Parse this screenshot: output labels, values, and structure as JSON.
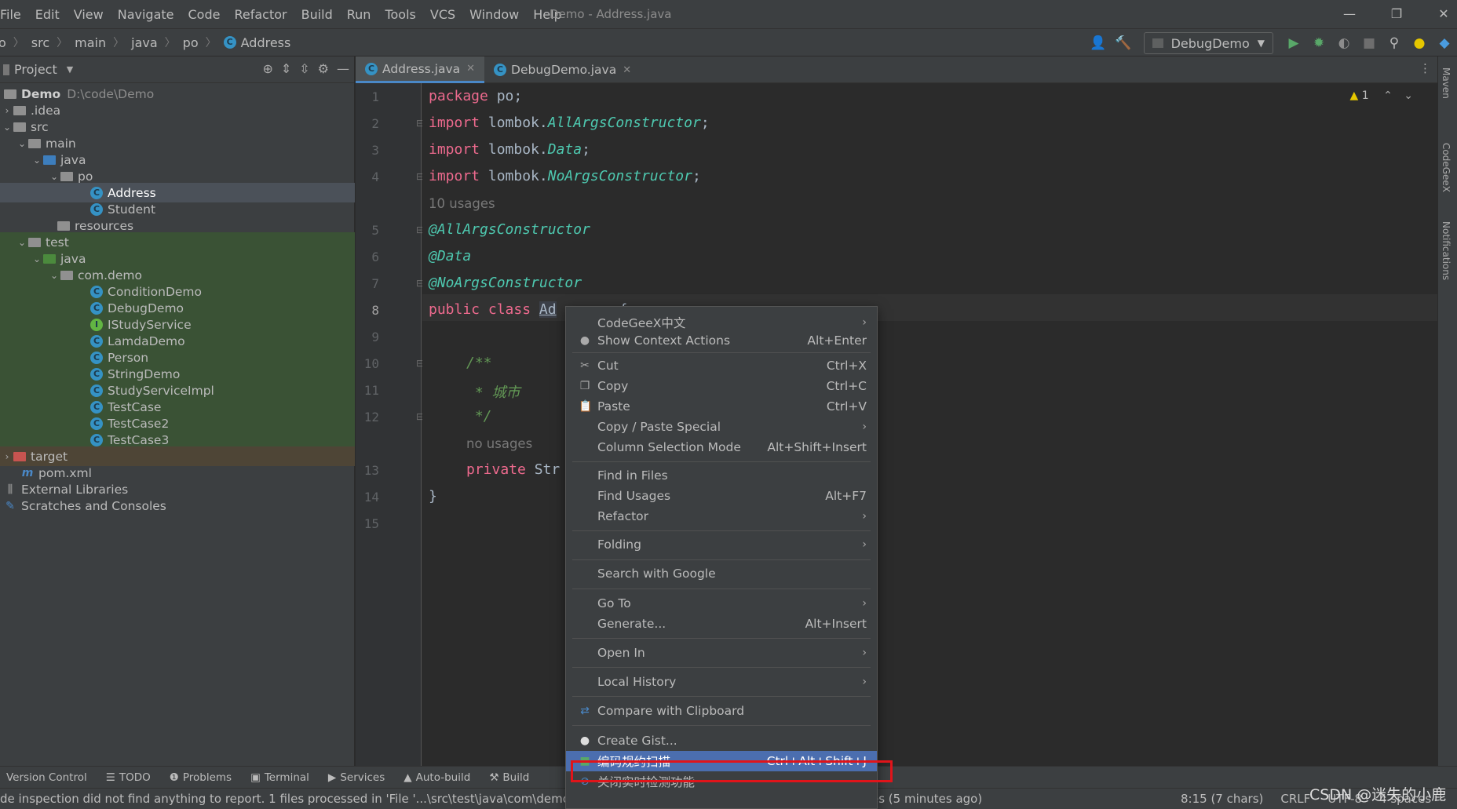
{
  "menu": [
    "File",
    "Edit",
    "View",
    "Navigate",
    "Code",
    "Refactor",
    "Build",
    "Run",
    "Tools",
    "VCS",
    "Window",
    "Help"
  ],
  "window_title": "Demo - Address.java",
  "breadcrumb": [
    "o",
    "src",
    "main",
    "java",
    "po",
    "Address"
  ],
  "run_config": "DebugDemo",
  "project": {
    "title": "Project",
    "root_name": "Demo",
    "root_path": "D:\\code\\Demo",
    "items": {
      "idea": ".idea",
      "src": "src",
      "main": "main",
      "java_main": "java",
      "po": "po",
      "address": "Address",
      "student": "Student",
      "resources": "resources",
      "test": "test",
      "java_test": "java",
      "com_demo": "com.demo",
      "condition_demo": "ConditionDemo",
      "debug_demo": "DebugDemo",
      "istudy_service": "IStudyService",
      "lamda_demo": "LamdaDemo",
      "person": "Person",
      "string_demo": "StringDemo",
      "study_service_impl": "StudyServiceImpl",
      "test_case": "TestCase",
      "test_case2": "TestCase2",
      "test_case3": "TestCase3",
      "target": "target",
      "pom": "pom.xml",
      "external_libraries": "External Libraries",
      "scratches": "Scratches and Consoles"
    }
  },
  "tabs": [
    "Address.java",
    "DebugDemo.java"
  ],
  "line_numbers": [
    "1",
    "2",
    "3",
    "4",
    "5",
    "6",
    "7",
    "8",
    "9",
    "10",
    "11",
    "12",
    "13",
    "14",
    "15"
  ],
  "code": {
    "l1_kw": "package",
    "l1_rest": " po;",
    "l2_kw": "import",
    "l2_pkg": " lombok.",
    "l2_cls": "AllArgsConstructor",
    "l3_kw": "import",
    "l3_pkg": " lombok.",
    "l3_cls": "Data",
    "l4_kw": "import",
    "l4_pkg": " lombok.",
    "l4_cls": "NoArgsConstructor",
    "semi": ";",
    "hint_usages": "10 usages",
    "l5": "@AllArgsConstructor",
    "l6": "@Data",
    "l7": "@NoArgsConstructor",
    "l8_kw": "public class",
    "l8_name": "Ad",
    "l8_rest": "{",
    "l10": "/**",
    "l11": " * 城市",
    "l12": " */",
    "hint_no_usages": "no usages",
    "l13_kw": "private",
    "l13_rest": "Str",
    "l14": "}"
  },
  "warning_count": "1",
  "context_menu": [
    {
      "label": "CodeGeeX中文",
      "shortcut": "",
      "submenu": true
    },
    {
      "label": "Show Context Actions",
      "shortcut": "Alt+Enter",
      "icon": "lightbulb-icon"
    },
    {
      "label": "Cut",
      "shortcut": "Ctrl+X",
      "icon": "scissors-icon"
    },
    {
      "label": "Copy",
      "shortcut": "Ctrl+C",
      "icon": "copy-icon"
    },
    {
      "label": "Paste",
      "shortcut": "Ctrl+V",
      "icon": "paste-icon"
    },
    {
      "label": "Copy / Paste Special",
      "shortcut": "",
      "submenu": true
    },
    {
      "label": "Column Selection Mode",
      "shortcut": "Alt+Shift+Insert"
    },
    {
      "label": "Find in Files",
      "shortcut": ""
    },
    {
      "label": "Find Usages",
      "shortcut": "Alt+F7"
    },
    {
      "label": "Refactor",
      "shortcut": "",
      "submenu": true
    },
    {
      "label": "Folding",
      "shortcut": "",
      "submenu": true
    },
    {
      "label": "Search with Google",
      "shortcut": ""
    },
    {
      "label": "Go To",
      "shortcut": "",
      "submenu": true
    },
    {
      "label": "Generate...",
      "shortcut": "Alt+Insert"
    },
    {
      "label": "Open In",
      "shortcut": "",
      "submenu": true
    },
    {
      "label": "Local History",
      "shortcut": "",
      "submenu": true
    },
    {
      "label": "Compare with Clipboard",
      "shortcut": "",
      "icon": "compare-icon"
    },
    {
      "label": "Create Gist...",
      "shortcut": "",
      "icon": "github-icon"
    },
    {
      "label": "编码规约扫描",
      "shortcut": "Ctrl+Alt+Shift+J",
      "icon": "scan-icon",
      "highlighted": true
    },
    {
      "label": "关闭实时检测功能",
      "shortcut": "",
      "icon": "disable-icon"
    }
  ],
  "bottom_tools": [
    "Version Control",
    "TODO",
    "Problems",
    "Terminal",
    "Services",
    "Auto-build",
    "Build"
  ],
  "status": {
    "message": "de inspection did not find anything to report. 1 files processed in 'File '...\\src\\test\\java\\com\\demo\\D",
    "message_end": "es (5 minutes ago)",
    "position": "8:15 (7 chars)",
    "line_sep": "CRLF",
    "encoding": "UTF-8",
    "indent": "4 spaces"
  },
  "watermark": "CSDN @迷失的小鹿",
  "right_strip": [
    "Maven",
    "CodeGeeX",
    "Notifications"
  ],
  "colors": {
    "accent": "#4b6eaf",
    "highlight_box": "#e0141a",
    "keyword": "#cc7832",
    "annotation": "#bbb529"
  }
}
